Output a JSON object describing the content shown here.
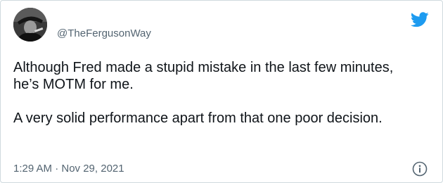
{
  "tweet": {
    "handle": "@TheFergusonWay",
    "paragraphs": [
      "Although Fred made a stupid mistake in the last few minutes, he’s MOTM for me.",
      "A very solid performance apart from that one poor decision."
    ],
    "timestamp": "1:29 AM · Nov 29, 2021"
  },
  "icons": {
    "brand": "twitter-bird-icon",
    "info": "info-icon",
    "avatar": "profile-avatar"
  },
  "colors": {
    "brand_blue": "#1d9bf0",
    "text_primary": "#0f1419",
    "text_secondary": "#536471",
    "border": "#cfd9de"
  }
}
